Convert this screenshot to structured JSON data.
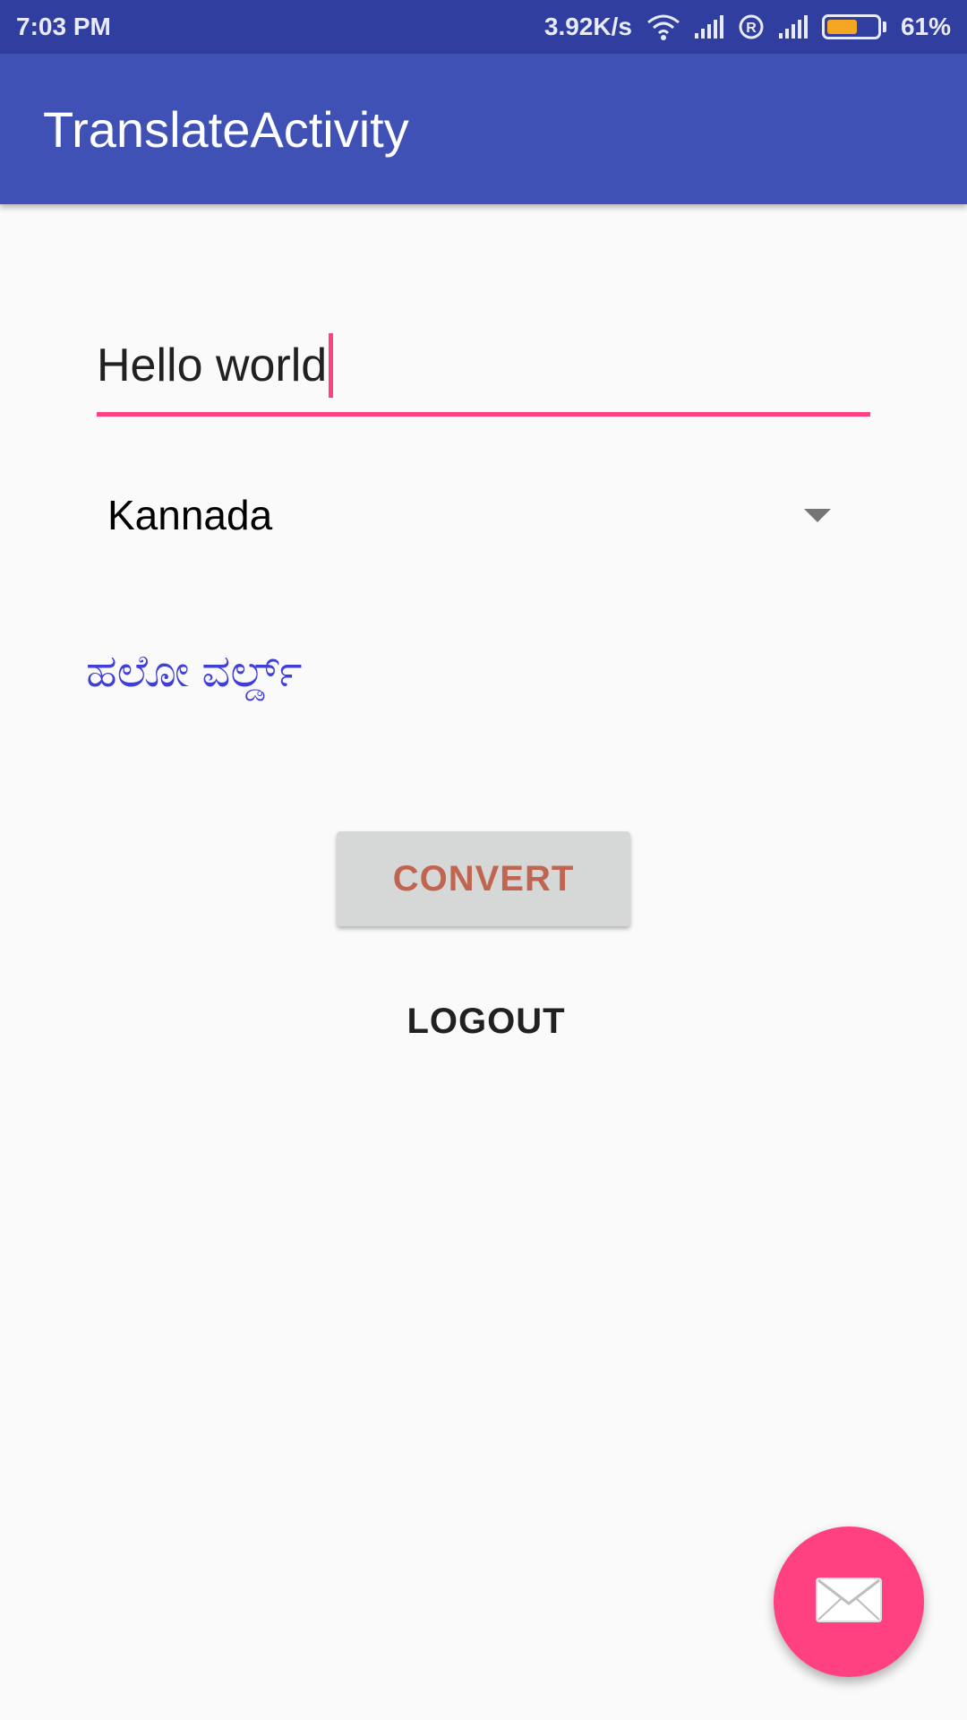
{
  "status_bar": {
    "time": "7:03 PM",
    "network_speed": "3.92K/s",
    "battery_percent": "61%",
    "battery_level": 0.61,
    "icons": [
      "wifi-icon",
      "signal-icon",
      "roaming-icon",
      "signal-icon",
      "battery-icon"
    ]
  },
  "app_bar": {
    "title": "TranslateActivity"
  },
  "input": {
    "value": "Hello world"
  },
  "language_spinner": {
    "selected": "Kannada"
  },
  "result": {
    "text": "ಹಲೋ ವರ್ಲ್ಡ್"
  },
  "buttons": {
    "convert_label": "CONVERT",
    "logout_label": "LOGOUT"
  },
  "fab": {
    "icon": "mail-icon"
  },
  "colors": {
    "primary": "#3f51b5",
    "primary_dark": "#303f9f",
    "accent": "#ff4081",
    "result_text": "#3f3fd8",
    "convert_text": "#c0654f"
  }
}
